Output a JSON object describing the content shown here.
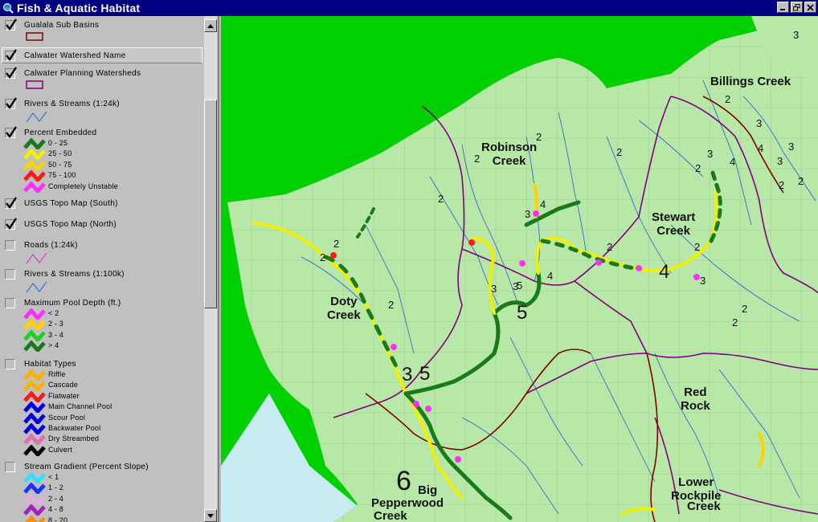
{
  "window": {
    "title": "Fish & Aquatic Habitat"
  },
  "legend": {
    "layers": [
      {
        "name": "Gualala Sub Basins",
        "checked": true
      },
      {
        "name": "Calwater Watershed Name",
        "checked": true
      },
      {
        "name": "Calwater Planning Watersheds",
        "checked": true
      },
      {
        "name": "Rivers & Streams (1:24k)",
        "checked": true
      },
      {
        "name": "Percent Embedded",
        "checked": true,
        "classes": [
          {
            "label": "0 - 25",
            "color": "#1a7a1a"
          },
          {
            "label": "25 - 50",
            "color": "#f0f000"
          },
          {
            "label": "50 - 75",
            "color": "#ffd200"
          },
          {
            "label": "75 - 100",
            "color": "#ff1a1a"
          },
          {
            "label": "Completely Unstable",
            "color": "#ff30ff"
          }
        ]
      },
      {
        "name": "USGS Topo Map (South)",
        "checked": true
      },
      {
        "name": "USGS Topo Map (North)",
        "checked": true
      },
      {
        "name": "Roads (1:24k)",
        "checked": false
      },
      {
        "name": "Rivers & Streams (1:100k)",
        "checked": false
      },
      {
        "name": "Maximum Pool Depth (ft.)",
        "checked": false,
        "classes": [
          {
            "label": "< 2",
            "color": "#ff30ff"
          },
          {
            "label": "2 - 3",
            "color": "#ffd200"
          },
          {
            "label": "3 - 4",
            "color": "#20d020"
          },
          {
            "label": "> 4",
            "color": "#1a7a1a"
          }
        ]
      },
      {
        "name": "Habitat Types",
        "checked": false,
        "classes": [
          {
            "label": "Riffle",
            "color": "#ffb000"
          },
          {
            "label": "Cascade",
            "color": "#ffb000"
          },
          {
            "label": "Flatwater",
            "color": "#ff1a1a"
          },
          {
            "label": "Main Channel Pool",
            "color": "#0000e0"
          },
          {
            "label": "Scour Pool",
            "color": "#0000e0"
          },
          {
            "label": "Backwater Pool",
            "color": "#0000e0"
          },
          {
            "label": "Dry Streambed",
            "color": "#e070b0"
          },
          {
            "label": "Culvert",
            "color": "#000000"
          }
        ]
      },
      {
        "name": "Stream Gradient (Percent Slope)",
        "checked": false,
        "classes": [
          {
            "label": "< 1",
            "color": "#30e0ff"
          },
          {
            "label": "1 - 2",
            "color": "#2030ff"
          },
          {
            "label": "2 - 4",
            "color": "#e0b0e0"
          },
          {
            "label": "4 - 8",
            "color": "#a020c0"
          },
          {
            "label": "8 - 20",
            "color": "#ff9000"
          }
        ]
      }
    ]
  },
  "map": {
    "watersheds": [
      {
        "name_line1": "Billings Creek",
        "name_line2": ""
      },
      {
        "name_line1": "Robinson",
        "name_line2": "Creek"
      },
      {
        "name_line1": "Stewart",
        "name_line2": "Creek"
      },
      {
        "name_line1": "Doty",
        "name_line2": "Creek"
      },
      {
        "name_line1": "Red",
        "name_line2": "Rock"
      },
      {
        "name_line1": "Lower",
        "name_line2": "Rockpile"
      },
      {
        "name_line1": "Creek",
        "name_line2": ""
      },
      {
        "name_line1": "Big",
        "name_line2": "Pepperwood"
      },
      {
        "name_line1": "Creek",
        "name_line2": ""
      }
    ],
    "stream_orders": [
      "3",
      "2",
      "3",
      "3",
      "4",
      "3",
      "2",
      "2",
      "2",
      "2",
      "2",
      "2",
      "4",
      "3",
      "3",
      "4",
      "5",
      "3",
      "4",
      "2",
      "2",
      "3",
      "5",
      "2",
      "2",
      "4",
      "3",
      "2",
      "3",
      "2",
      "2",
      "2",
      "6"
    ]
  },
  "colors": {
    "title_bar": "#000080",
    "ocean": "#00d000",
    "land": "#b8e8a8",
    "watershed_boundary": "#800080",
    "subbasin_boundary": "#800000",
    "stream": "#2060d0"
  }
}
